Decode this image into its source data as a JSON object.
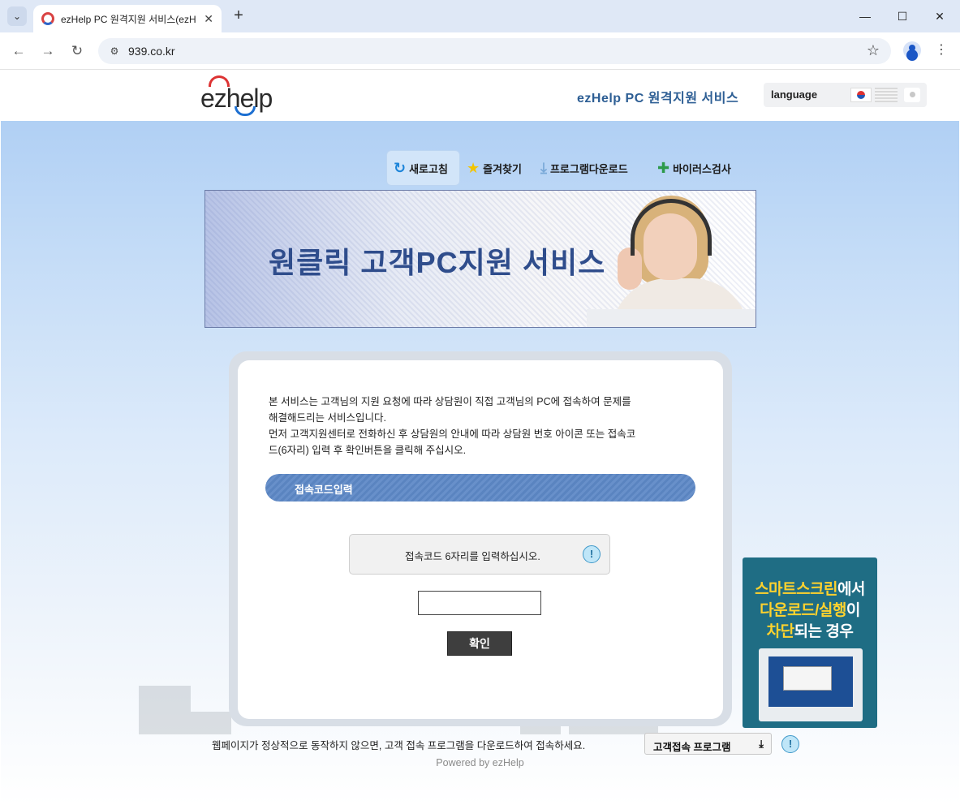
{
  "browser": {
    "tab_title": "ezHelp PC 원격지원 서비스(ezH",
    "tab_close": "✕",
    "new_tab": "+",
    "url": "939.co.kr",
    "controls": {
      "minimize": "—",
      "maximize": "☐",
      "close": "✕"
    },
    "nav": {
      "back": "←",
      "forward": "→",
      "reload": "↻"
    }
  },
  "header": {
    "logo": "ezhelp",
    "service_title": "ezHelp PC 원격지원 서비스",
    "language_label": "language"
  },
  "quick_menu": {
    "refresh": "새로고침",
    "favorites": "즐겨찾기",
    "download": "프로그램다운로드",
    "virus": "바이러스검사"
  },
  "banner": {
    "title": "원클릭 고객PC지원 서비스"
  },
  "main": {
    "description_line1": "본 서비스는 고객님의 지원 요청에 따라 상담원이 직접 고객님의 PC에 접속하여 문제를",
    "description_line2": "해결해드리는 서비스입니다.",
    "description_line3": "먼저 고객지원센터로 전화하신 후 상담원의 안내에 따라 상담원 번호 아이콘 또는 접속코",
    "description_line4": "드(6자리) 입력 후 확인버튼을 클릭해 주십시오.",
    "code_section_label": "접속코드입력",
    "notice": "접속코드 6자리를 입력하십시오.",
    "code_input_value": "",
    "confirm_button": "확인"
  },
  "side_ad": {
    "line1_highlight": "스마트스크린",
    "line1_rest": "에서",
    "line2_highlight": "다운로드/실행",
    "line2_rest": "이",
    "line3_highlight": "차단",
    "line3_rest": "되는 경우"
  },
  "footer": {
    "message": "웹페이지가 정상적으로 동작하지 않으면, 고객 접속 프로그램을 다운로드하여 접속하세요.",
    "download_button": "고객접속 프로그램",
    "powered_by": "Powered by ezHelp"
  },
  "colors": {
    "header_title": "#2d5e94",
    "code_bar": "#5a84c0",
    "banner_text": "#2f4d8c",
    "ad_background": "#1f6d84",
    "ad_highlight": "#ffd22e"
  },
  "icons": {
    "tab_search": "chevron-down-icon",
    "site_info": "tune-icon",
    "bookmark": "star-outline-icon",
    "refresh": "refresh-icon",
    "favorites": "star-icon",
    "download": "download-icon",
    "virus": "syringe-icon",
    "info": "info-icon"
  }
}
